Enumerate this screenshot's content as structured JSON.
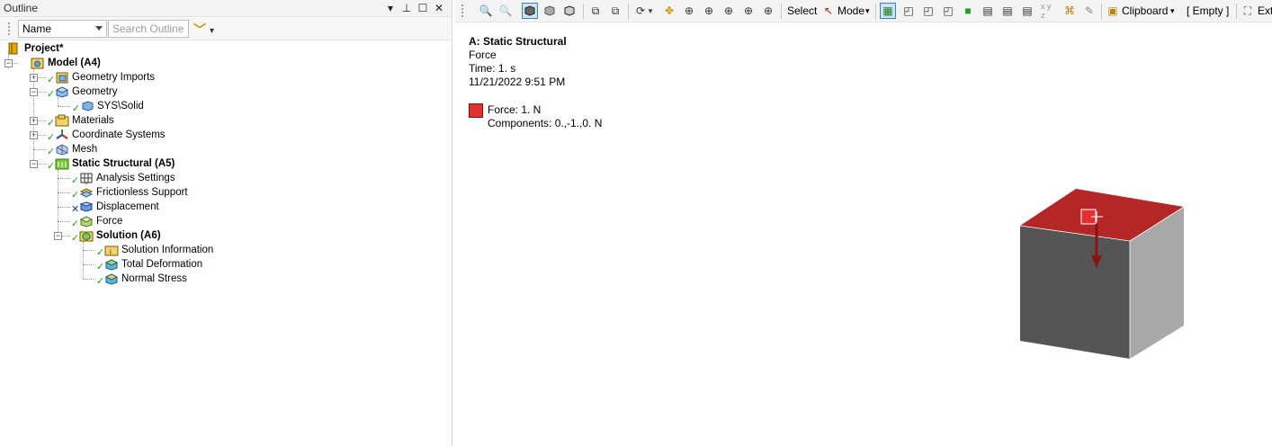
{
  "outline": {
    "title": "Outline",
    "filter": {
      "selected": "Name",
      "search_placeholder": "Search Outline"
    }
  },
  "tree": [
    {
      "label": "Project*",
      "bold": true,
      "icon": "project-icon"
    },
    {
      "label": "Model (A4)",
      "bold": true,
      "icon": "model-icon"
    },
    {
      "label": "Geometry Imports",
      "bold": false,
      "icon": "geometry-imports-icon",
      "status": "ok"
    },
    {
      "label": "Geometry",
      "bold": false,
      "icon": "geometry-icon",
      "status": "ok"
    },
    {
      "label": "SYS\\Solid",
      "bold": false,
      "icon": "solid-body-icon",
      "status": "ok"
    },
    {
      "label": "Materials",
      "bold": false,
      "icon": "materials-icon",
      "status": "ok"
    },
    {
      "label": "Coordinate Systems",
      "bold": false,
      "icon": "coordinate-systems-icon",
      "status": "ok"
    },
    {
      "label": "Mesh",
      "bold": false,
      "icon": "mesh-icon",
      "status": "ok"
    },
    {
      "label": "Static Structural (A5)",
      "bold": true,
      "icon": "static-structural-icon",
      "status": "ok"
    },
    {
      "label": "Analysis Settings",
      "bold": false,
      "icon": "analysis-settings-icon",
      "status": "ok"
    },
    {
      "label": "Frictionless Support",
      "bold": false,
      "icon": "frictionless-support-icon",
      "status": "ok"
    },
    {
      "label": "Displacement",
      "bold": false,
      "icon": "displacement-icon",
      "status": "x"
    },
    {
      "label": "Force",
      "bold": false,
      "icon": "force-icon",
      "status": "ok"
    },
    {
      "label": "Solution (A6)",
      "bold": true,
      "icon": "solution-icon",
      "status": "ok"
    },
    {
      "label": "Solution Information",
      "bold": false,
      "icon": "solution-information-icon",
      "status": "ok"
    },
    {
      "label": "Total Deformation",
      "bold": false,
      "icon": "total-deformation-icon",
      "status": "ok"
    },
    {
      "label": "Normal Stress",
      "bold": false,
      "icon": "normal-stress-icon",
      "status": "ok"
    }
  ],
  "toolbar": {
    "select_label": "Select",
    "mode_label": "Mode",
    "clipboard_label": "Clipboard",
    "empty_label": "[ Empty ]",
    "ext_label": "Ext"
  },
  "viewport": {
    "title": "A: Static Structural",
    "object": "Force",
    "time": "Time: 1. s",
    "date": "11/21/2022 9:51 PM",
    "legend_label": "Force: 1. N",
    "legend_components": "Components: 0.,-1.,0. N",
    "colors": {
      "force": "#e03030",
      "top_face": "#b52626",
      "front_face": "#555555",
      "side_face": "#a8a8a8"
    }
  }
}
